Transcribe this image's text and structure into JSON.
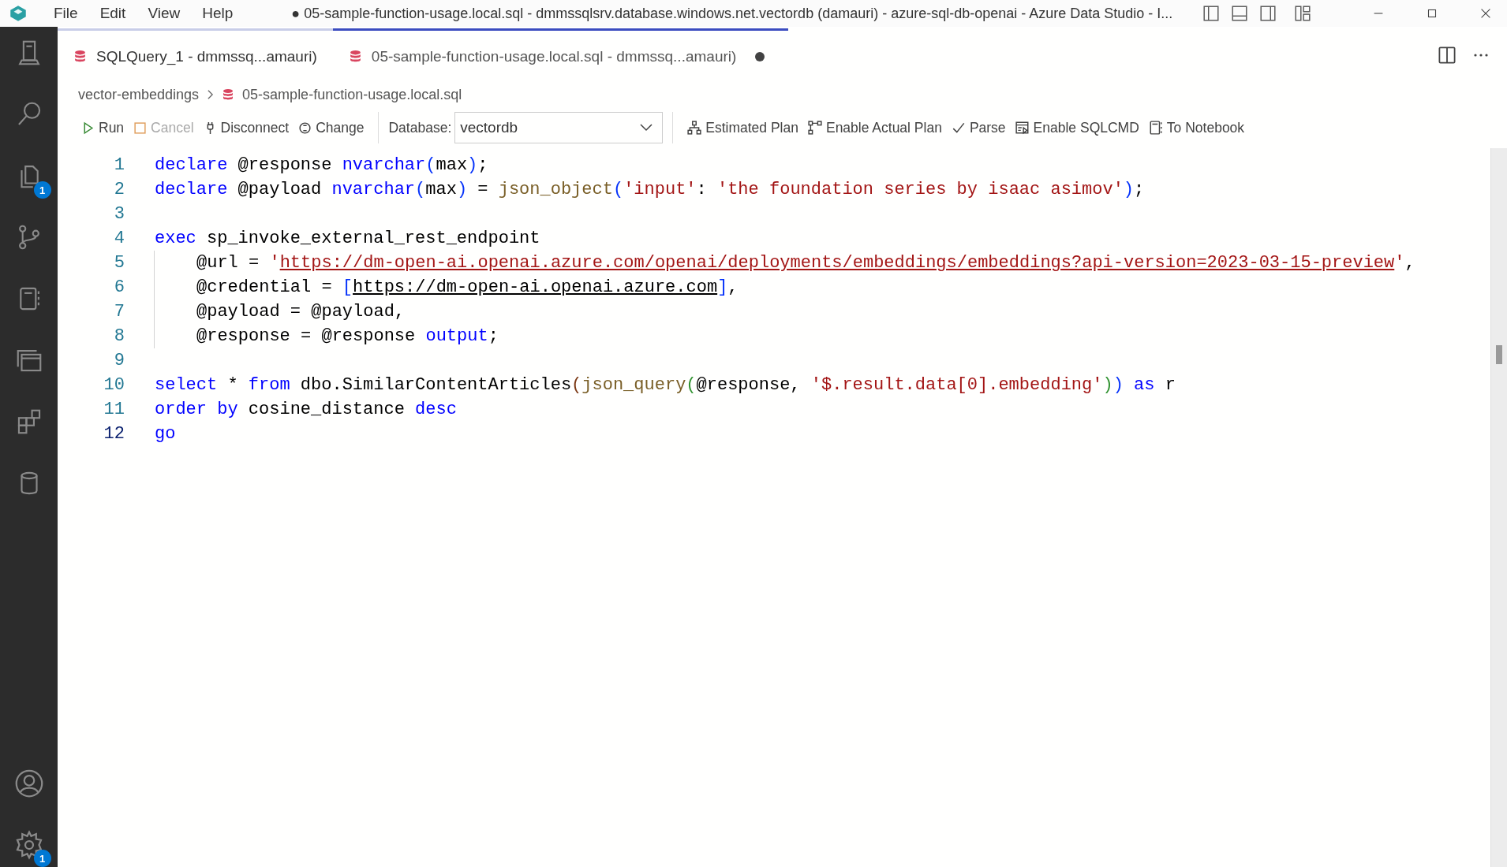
{
  "title_bar": {
    "menus": [
      "File",
      "Edit",
      "View",
      "Help"
    ],
    "title": "● 05-sample-function-usage.local.sql - dmmssqlsrv.database.windows.net.vectordb (damauri) - azure-sql-db-openai - Azure Data Studio - I..."
  },
  "activity_bar": {
    "items": [
      {
        "kind": "server"
      },
      {
        "kind": "search"
      },
      {
        "kind": "files",
        "badge": "1"
      },
      {
        "kind": "branch"
      },
      {
        "kind": "notebook"
      },
      {
        "kind": "windows"
      },
      {
        "kind": "extensions"
      },
      {
        "kind": "database"
      }
    ],
    "bottom": [
      {
        "kind": "account"
      },
      {
        "kind": "settings",
        "badge": "1"
      }
    ]
  },
  "tabs": [
    {
      "label": "SQLQuery_1 - dmmssq...amauri)",
      "selected": false,
      "dirty": false
    },
    {
      "label": "05-sample-function-usage.local.sql - dmmssq...amauri)",
      "selected": true,
      "dirty": true
    }
  ],
  "breadcrumb": [
    "vector-embeddings",
    "05-sample-function-usage.local.sql"
  ],
  "toolbar": {
    "left": [
      {
        "kind": "run",
        "label": "Run",
        "disabled": false
      },
      {
        "kind": "cancel",
        "label": "Cancel",
        "disabled": true
      },
      {
        "kind": "disconnect",
        "label": "Disconnect",
        "disabled": false
      },
      {
        "kind": "change",
        "label": "Change",
        "disabled": false
      }
    ],
    "database_label": "Database:",
    "database_value": "vectordb",
    "right": [
      {
        "kind": "plan",
        "label": "Estimated Plan",
        "disabled": false
      },
      {
        "kind": "actual",
        "label": "Enable Actual Plan",
        "disabled": false
      },
      {
        "kind": "parse",
        "label": "Parse",
        "disabled": false
      },
      {
        "kind": "sqlcmd",
        "label": "Enable SQLCMD",
        "disabled": false
      },
      {
        "kind": "notebook",
        "label": "To Notebook",
        "disabled": false
      }
    ]
  },
  "editor": {
    "lines": [
      {
        "number": "1",
        "indented": false,
        "current": false,
        "tokens": [
          {
            "kind": "kw",
            "text": "declare"
          },
          {
            "kind": "plain",
            "text": " @response "
          },
          {
            "kind": "kw",
            "text": "nvarchar"
          },
          {
            "kind": "br1",
            "text": "("
          },
          {
            "kind": "plain",
            "text": "max"
          },
          {
            "kind": "br1",
            "text": ")"
          },
          {
            "kind": "plain",
            "text": ";"
          }
        ]
      },
      {
        "number": "2",
        "indented": false,
        "current": false,
        "tokens": [
          {
            "kind": "kw",
            "text": "declare"
          },
          {
            "kind": "plain",
            "text": " @payload "
          },
          {
            "kind": "kw",
            "text": "nvarchar"
          },
          {
            "kind": "br1",
            "text": "("
          },
          {
            "kind": "plain",
            "text": "max"
          },
          {
            "kind": "br1",
            "text": ")"
          },
          {
            "kind": "plain",
            "text": " = "
          },
          {
            "kind": "fn",
            "text": "json_object"
          },
          {
            "kind": "br1",
            "text": "("
          },
          {
            "kind": "str",
            "text": "'input'"
          },
          {
            "kind": "plain",
            "text": ": "
          },
          {
            "kind": "str",
            "text": "'the foundation series by isaac asimov'"
          },
          {
            "kind": "br1",
            "text": ")"
          },
          {
            "kind": "plain",
            "text": ";"
          }
        ]
      },
      {
        "number": "3",
        "indented": false,
        "current": false
      },
      {
        "number": "4",
        "indented": false,
        "current": false,
        "tokens": [
          {
            "kind": "kw",
            "text": "exec"
          },
          {
            "kind": "plain",
            "text": " sp_invoke_external_rest_endpoint"
          }
        ]
      },
      {
        "number": "5",
        "indented": true,
        "current": false,
        "tokens": [
          {
            "kind": "plain",
            "text": "@url = "
          },
          {
            "kind": "str",
            "text": "'"
          },
          {
            "kind": "strlink",
            "text": "https://dm-open-ai.openai.azure.com/openai/deployments/embeddings/embeddings?api-version=2023-03-15-preview"
          },
          {
            "kind": "str",
            "text": "'"
          },
          {
            "kind": "plain",
            "text": ","
          }
        ]
      },
      {
        "number": "6",
        "indented": true,
        "current": false,
        "tokens": [
          {
            "kind": "plain",
            "text": "@credential = "
          },
          {
            "kind": "br1",
            "text": "["
          },
          {
            "kind": "link",
            "text": "https://dm-open-ai.openai.azure.com"
          },
          {
            "kind": "br1",
            "text": "]"
          },
          {
            "kind": "plain",
            "text": ","
          }
        ]
      },
      {
        "number": "7",
        "indented": true,
        "current": false,
        "tokens": [
          {
            "kind": "plain",
            "text": "@payload = @payload,"
          }
        ]
      },
      {
        "number": "8",
        "indented": true,
        "current": false,
        "tokens": [
          {
            "kind": "plain",
            "text": "@response = @response "
          },
          {
            "kind": "kw",
            "text": "output"
          },
          {
            "kind": "plain",
            "text": ";"
          }
        ]
      },
      {
        "number": "9",
        "indented": false,
        "current": false
      },
      {
        "number": "10",
        "indented": false,
        "current": false,
        "tokens": [
          {
            "kind": "kw",
            "text": "select"
          },
          {
            "kind": "plain",
            "text": " * "
          },
          {
            "kind": "kw",
            "text": "from"
          },
          {
            "kind": "plain",
            "text": " dbo.SimilarContentArticles"
          },
          {
            "kind": "br3",
            "text": "("
          },
          {
            "kind": "fn",
            "text": "json_query"
          },
          {
            "kind": "br2",
            "text": "("
          },
          {
            "kind": "plain",
            "text": "@response, "
          },
          {
            "kind": "str",
            "text": "'$.result.data[0].embedding'"
          },
          {
            "kind": "br2",
            "text": ")"
          },
          {
            "kind": "br1",
            "text": ") "
          },
          {
            "kind": "kw",
            "text": "as"
          },
          {
            "kind": "plain",
            "text": " r"
          }
        ]
      },
      {
        "number": "11",
        "indented": false,
        "current": false,
        "tokens": [
          {
            "kind": "kw",
            "text": "order by"
          },
          {
            "kind": "plain",
            "text": " cosine_distance "
          },
          {
            "kind": "kw",
            "text": "desc"
          }
        ]
      },
      {
        "number": "12",
        "indented": false,
        "current": true,
        "tokens": [
          {
            "kind": "kw",
            "text": "go"
          }
        ]
      }
    ]
  }
}
